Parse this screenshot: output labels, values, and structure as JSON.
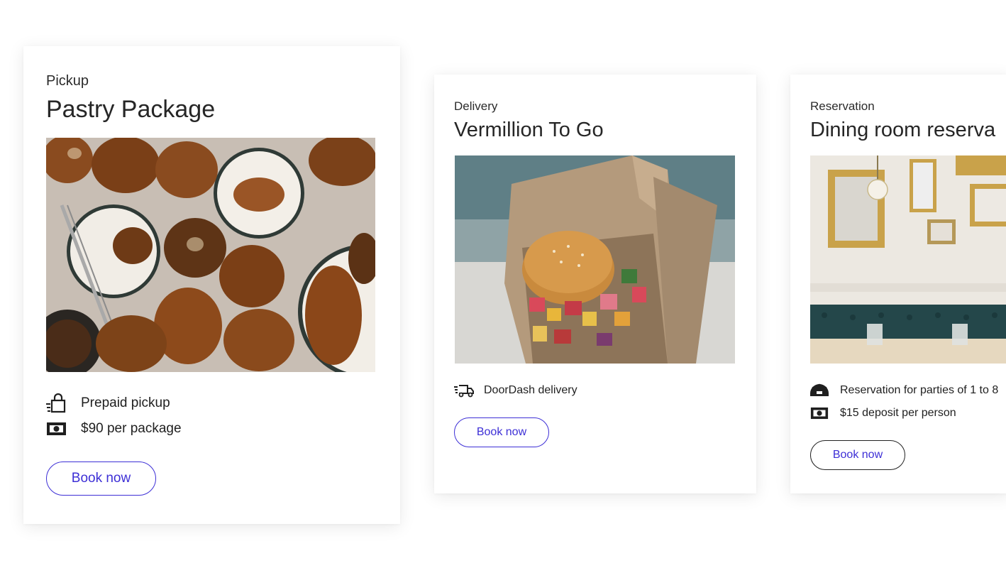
{
  "cards": [
    {
      "kind": "Pickup",
      "title": "Pastry Package",
      "features": [
        {
          "icon": "shopping-bag-icon",
          "text": "Prepaid pickup"
        },
        {
          "icon": "cash-icon",
          "text": "$90 per package"
        }
      ],
      "button": "Book now"
    },
    {
      "kind": "Delivery",
      "title": "Vermillion To Go",
      "features": [
        {
          "icon": "delivery-truck-icon",
          "text": "DoorDash delivery"
        }
      ],
      "button": "Book now"
    },
    {
      "kind": "Reservation",
      "title": "Dining room reserva",
      "features": [
        {
          "icon": "party-people-icon",
          "text": "Reservation for parties of 1 to 8"
        },
        {
          "icon": "cash-icon",
          "text": "$15 deposit per person"
        }
      ],
      "button": "Book now"
    }
  ],
  "colors": {
    "accent": "#3d2fd6",
    "text": "#1f1f1f"
  }
}
